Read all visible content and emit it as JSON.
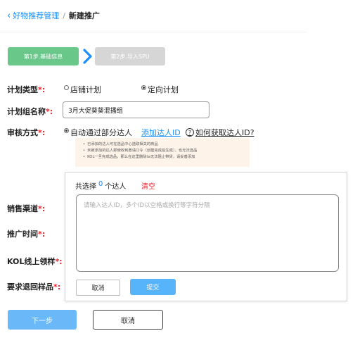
{
  "breadcrumb": {
    "parent": "好物推荐管理",
    "separator": "/",
    "current": "新建推广"
  },
  "steps": [
    {
      "label": "第1步.基础信息",
      "status": "active",
      "color": "#69c78a"
    },
    {
      "label": "第2步.导入SPU",
      "status": "inactive",
      "color": "#d6d6d6"
    }
  ],
  "form": {
    "plan_type": {
      "label": "计划类型",
      "required_mark": "*:",
      "options": [
        {
          "label": "店铺计划",
          "checked": false
        },
        {
          "label": "定向计划",
          "checked": true
        }
      ]
    },
    "group_name": {
      "label": "计划组名称",
      "required_mark": "*:",
      "value": "3月大促葵葵混播组"
    },
    "review_mode": {
      "label": "审核方式",
      "required_mark": "*:",
      "option_label": "自动通过部分达人",
      "add_link": "添加达人ID",
      "help_icon": "?",
      "help_link": "如何获取达人ID?",
      "notices": [
        "已添加的达人可在选品中心选取相关的商品",
        "未被添加的达人即使收到邀请口令（创建完成后生成），也无法选品",
        "KOL一旦完成选品，那么在这里删除ta无法阻止带货，请妥善添加"
      ]
    },
    "sales_channel": {
      "label": "销售渠道",
      "required_mark": "*:"
    },
    "promo_time": {
      "label": "推广时间",
      "required_mark": "*:"
    },
    "kol_sample": {
      "label": "KOL线上领样",
      "required_mark": "*:"
    },
    "return_sample": {
      "label": "要求退回样品",
      "required_mark": "*:"
    }
  },
  "popup": {
    "selected_prefix": "共选择",
    "selected_count": "0",
    "selected_suffix": "个达人",
    "clear_label": "清空",
    "textarea_placeholder": "请输入达人ID，多个ID以空格或换行等字符分隔",
    "cancel_label": "取消",
    "submit_label": "提交"
  },
  "footer": {
    "next_label": "下一步",
    "cancel_label": "取消"
  },
  "colors": {
    "accent": "#1890ff",
    "required": "#f5222d",
    "step_active": "#69c78a",
    "primary_button": "#6ab8f7"
  }
}
